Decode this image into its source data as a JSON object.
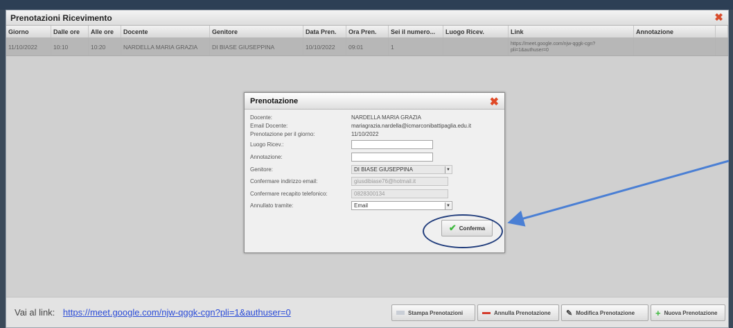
{
  "window": {
    "title": "Prenotazioni Ricevimento",
    "close_icon": "close-icon"
  },
  "table": {
    "columns": [
      "Giorno",
      "Dalle ore",
      "Alle ore",
      "Docente",
      "Genitore",
      "Data Pren.",
      "Ora Pren.",
      "Sei il numero...",
      "Luogo Ricev.",
      "Link",
      "Annotazione"
    ],
    "rows": [
      {
        "giorno": "11/10/2022",
        "dalle": "10:10",
        "alle": "10:20",
        "docente": "NARDELLA MARIA GRAZIA",
        "genitore": "DI BIASE GIUSEPPINA",
        "data_pren": "10/10/2022",
        "ora_pren": "09:01",
        "numero": "1",
        "luogo": "",
        "link": "https://meet.google.com/njw-qggk-cgn?pli=1&authuser=0",
        "annotazione": ""
      }
    ]
  },
  "dialog": {
    "title": "Prenotazione",
    "docente_label": "Docente:",
    "docente_value": "NARDELLA MARIA GRAZIA",
    "email_label": "Email Docente:",
    "email_value": "mariagrazia.nardella@icmarconibattipaglia.edu.it",
    "giorno_label": "Prenotazione per il giorno:",
    "giorno_value": "11/10/2022",
    "luogo_label": "Luogo Ricev.:",
    "luogo_value": "",
    "annotazione_label": "Annotazione:",
    "annotazione_value": "",
    "genitore_label": "Genitore:",
    "genitore_value": "DI BIASE GIUSEPPINA",
    "conf_email_label": "Confermare indirizzo email:",
    "conf_email_value": "giusdibiase76@hotmail.it",
    "conf_tel_label": "Confermare recapito telefonico:",
    "conf_tel_value": "0828300134",
    "annullato_label": "Annullato tramite:",
    "annullato_value": "Email",
    "confirm_label": "Conferma"
  },
  "footer": {
    "vai_label": "Vai al link:",
    "link": "https://meet.google.com/njw-qggk-cgn?pli=1&authuser=0",
    "buttons": {
      "stampa": "Stampa Prenotazioni",
      "annulla": "Annulla Prenotazione",
      "modifica": "Modifica Prenotazione",
      "nuova": "Nuova Prenotazione"
    }
  },
  "colors": {
    "accent_arrow": "#4a7fd4",
    "annotation_circle": "#213d7c",
    "close_red": "#d84b2b",
    "confirm_green": "#3db93d"
  }
}
